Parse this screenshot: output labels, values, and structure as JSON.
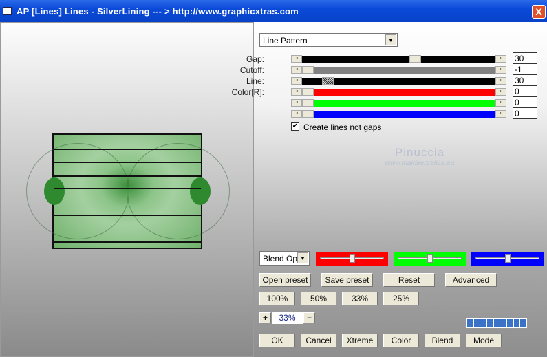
{
  "window": {
    "title": "AP [Lines]  Lines - SilverLining     --- > http://www.graphicxtras.com",
    "close_label": "X"
  },
  "filter_select": {
    "value": "Line Pattern"
  },
  "sliders": [
    {
      "label": "Gap:",
      "value": "30",
      "track_color": "#000000",
      "position": 0.59
    },
    {
      "label": "Cutoff:",
      "value": "-1",
      "track_color": "#808080",
      "position": 0.0
    },
    {
      "label": "Line:",
      "value": "30",
      "track_color": "#000000",
      "position": 0.11
    },
    {
      "label": "Color[R]:",
      "value": "0",
      "track_color": "#ff0000",
      "position": 0.0
    },
    {
      "label": "",
      "value": "0",
      "track_color": "#00ff00",
      "position": 0.0
    },
    {
      "label": "",
      "value": "0",
      "track_color": "#0000ff",
      "position": 0.0
    }
  ],
  "checkbox": {
    "label": "Create lines not gaps",
    "checked": true
  },
  "watermark": {
    "line1": "Pinuccia",
    "line2": "www.maidiregrafica.eu"
  },
  "blend_select": {
    "value": "Blend Optio"
  },
  "blend_sliders": [
    {
      "color": "#ff0000",
      "position": 0.5
    },
    {
      "color": "#00ff00",
      "position": 0.5
    },
    {
      "color": "#0000ff",
      "position": 0.5
    }
  ],
  "buttons_row1": [
    "Open preset",
    "Save preset",
    "Reset",
    "Advanced"
  ],
  "zoom_buttons": [
    "100%",
    "50%",
    "33%",
    "25%"
  ],
  "zoom": {
    "plus": "+",
    "value": "33%",
    "minus": "−"
  },
  "progress": {
    "segments": 9,
    "filled": 9
  },
  "bottom_buttons": [
    "OK",
    "Cancel",
    "Xtreme",
    "Color",
    "Blend",
    "Mode"
  ]
}
